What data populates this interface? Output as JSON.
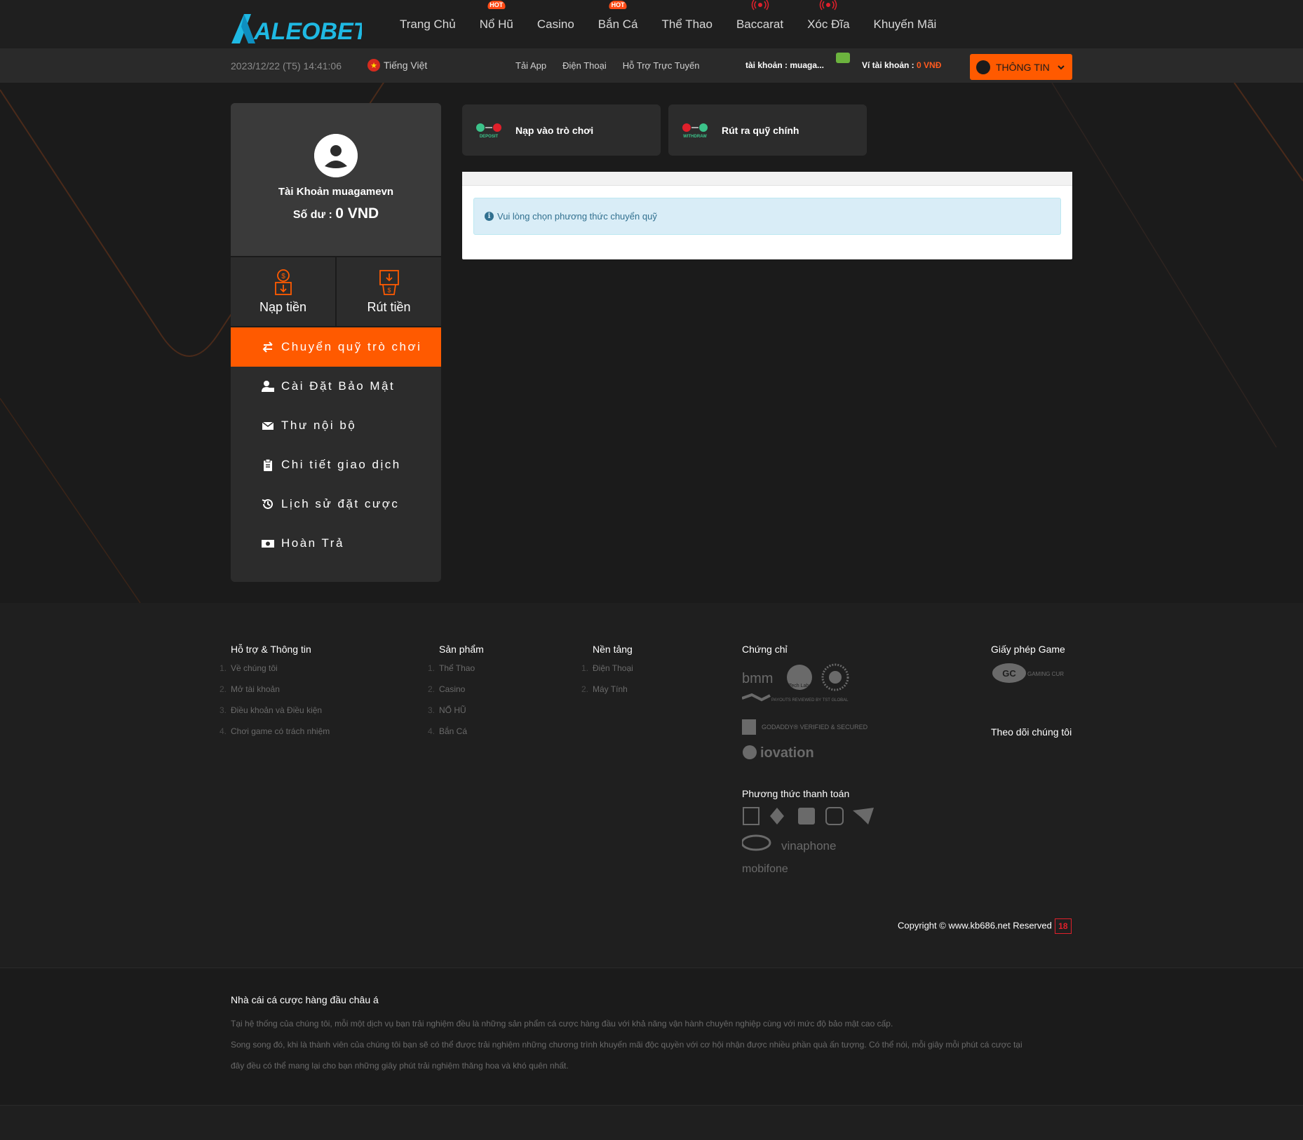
{
  "brand": {
    "logo_text": "ALEOBET",
    "accent": "#ff5a00",
    "logo_color": "#1fb9e3"
  },
  "nav": {
    "items": [
      {
        "label": "Trang Chủ",
        "badge": ""
      },
      {
        "label": "Nổ Hũ",
        "badge": "HOT"
      },
      {
        "label": "Casino",
        "badge": ""
      },
      {
        "label": "Bắn Cá",
        "badge": "HOT"
      },
      {
        "label": "Thể Thao",
        "badge": ""
      },
      {
        "label": "Baccarat",
        "badge": "LIVE"
      },
      {
        "label": "Xóc Đĩa",
        "badge": "LIVE"
      },
      {
        "label": "Khuyến Mãi",
        "badge": ""
      }
    ]
  },
  "subbar": {
    "datetime": "2023/12/22 (T5) 14:41:06",
    "language": "Tiếng Việt",
    "links": [
      "Tải App",
      "Điện Thoại",
      "Hỗ Trợ Trực Tuyến"
    ],
    "account": "tài khoản : muaga...",
    "wallet_label": "Ví tài khoản : ",
    "wallet_amount": "0 VNĐ",
    "info_button": "THÔNG TIN"
  },
  "sidebar": {
    "account_name": "Tài Khoản muagamevn",
    "balance_label": "Số dư : ",
    "balance_value": "0 VND",
    "deposit": "Nạp tiền",
    "withdraw": "Rút tiền",
    "menu": [
      {
        "label": "Chuyển quỹ trò chơi",
        "icon": "transfer-icon",
        "active": true
      },
      {
        "label": "Cài Đặt Bảo Mật",
        "icon": "user-lock-icon",
        "active": false
      },
      {
        "label": "Thư nội bộ",
        "icon": "envelope-icon",
        "active": false
      },
      {
        "label": "Chi tiết giao dịch",
        "icon": "clipboard-icon",
        "active": false
      },
      {
        "label": "Lịch sử đặt cược",
        "icon": "history-icon",
        "active": false
      },
      {
        "label": "Hoàn Trả",
        "icon": "money-icon",
        "active": false
      }
    ]
  },
  "main": {
    "tab_deposit": "Nạp vào trò chơi",
    "tab_deposit_icon_text": "DEPOSIT",
    "tab_withdraw": "Rút ra quỹ chính",
    "tab_withdraw_icon_text": "WITHDRAW",
    "alert": "Vui lòng chọn phương thức chuyển quỹ"
  },
  "footer": {
    "support": {
      "title": "Hỗ trợ & Thông tin",
      "items": [
        "Về chúng tôi",
        "Mở tài khoản",
        "Điều khoản và Điều kiện",
        "Chơi game có trách nhiệm"
      ]
    },
    "products": {
      "title": "Sản phẩm",
      "items": [
        "Thể Thao",
        "Casino",
        "NỔ HŨ",
        "Bắn Cá"
      ]
    },
    "platform": {
      "title": "Nền tảng",
      "items": [
        "Điện Thoại",
        "Máy Tính"
      ]
    },
    "certs": {
      "title": "Chứng chỉ",
      "logos": [
        "bmm",
        "iTech Labs",
        "PAYOUTS REVIEWED BY TST GLOBAL",
        "GODADDY® VERIFIED & SECURED",
        "iovation"
      ]
    },
    "payment": {
      "title": "Phương thức thanh toán",
      "logos": [
        "bank",
        "ethereum",
        "momo",
        "zalo",
        "viettel",
        "vinaphone",
        "mobifone"
      ]
    },
    "license": {
      "title": "Giấy phép Game",
      "logo": "GAMING CURAÇAO"
    },
    "follow": {
      "title": "Theo dõi chúng tôi"
    },
    "copyright": "Copyright © www.kb686.net Reserved",
    "age": "18"
  },
  "about": {
    "title": "Nhà cái cá cược hàng đầu châu á",
    "p1": "Tại hệ thống của chúng tôi, mỗi một dịch vụ bạn trải nghiệm đều là những sản phẩm cá cược hàng đầu với khả năng vận hành chuyên nghiệp cùng với mức độ bảo mật cao cấp.",
    "p2": "Song song đó, khi là thành viên của chúng tôi bạn sẽ có thể được trải nghiệm những chương trình khuyến mãi độc quyền với cơ hội nhận được nhiều phần quà ấn tượng. Có thể nói, mỗi giây mỗi phút cá cược tại đây đều có thể mang lại cho bạn những giây phút trải nghiệm thăng hoa và khó quên nhất."
  }
}
